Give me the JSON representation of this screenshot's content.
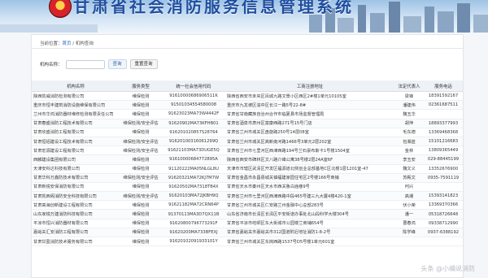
{
  "header": {
    "title": "甘肃省社会消防服务信息管理系统",
    "brand_color": "#1f4fa0"
  },
  "breadcrumb": {
    "prefix": "当前位置：",
    "home": "首页",
    "sep": " / ",
    "current": "机构查询"
  },
  "search": {
    "label": "机构名称：",
    "value": "",
    "placeholder": "",
    "query_label": "查询",
    "reset_label": "重置查询"
  },
  "table": {
    "columns": [
      "机构名称",
      "服务类型",
      "统一社会信用代码",
      "工商注册地址",
      "法定代表人",
      "服务电话"
    ],
    "rows": [
      [
        "陕西凯威消防检测有限公司",
        "维保检测",
        "91610000686906511K",
        "陕西省西安市未央区凤城九路文景小区西区2#楼1单元10105室",
        "梁锋",
        "18391592167"
      ],
      [
        "重庆市恒丰建筑消防设施维保有限公司",
        "维保检测",
        "91501034554580008",
        "重庆市九龙坡区渝中区长江一路5号22-8#",
        "潘建伟",
        "02361687511"
      ],
      [
        "兰州市华鸿消防器材维修检测有限责任公司",
        "维保检测",
        "91623023MA73W4442F",
        "甘肃省甘南藏族自治州合作市临夏县市场监督管理局",
        "魏玉华",
        ""
      ],
      [
        "甘肃春盛消防工程技术有限公司",
        "维保检测/安全评估",
        "91620902MA73KFHB01",
        "甘肃省酒泉市肃州区富康西路271号15号门店",
        "胡萍",
        "18893377993"
      ],
      [
        "甘肃欣盛消防工程有限公司",
        "维保检测",
        "916201020857S28764",
        "甘肃省兰州市城关区盘旋路250号14层08室",
        "毛东德",
        "13369468368"
      ],
      [
        "甘肃恒铝建设工程技术有限公司",
        "维保检测/安全评估",
        "91620100316061299Q",
        "甘肃省兰州市城关区高新南河路1466号3单元2层202室",
        "包湘蓝",
        "15101216683"
      ],
      [
        "甘肃宏源建设工程有限公司",
        "维保检测/安全评估",
        "91621103MA73DUGE5Q",
        "甘肃省兰州市七里河区西津西路194号兰石豪布斯卡1号楼1504室",
        "金林",
        "13809365449"
      ],
      [
        "西麟建设集团有限公司",
        "维保检测",
        "91610000684772895A",
        "陕西省西安市碑林区文八路介峰公寓38号楼2层24A室6F",
        "李玉安",
        "029-88445199"
      ],
      [
        "天津安科达科技有限公司",
        "维保检测",
        "91120222MA05NLGL8U",
        "天津市市辖区武清区开发区福源道北侧创业总部基地C区北楼1层1201室-47",
        "魏文义",
        "13352676900"
      ],
      [
        "甘肃华科万鑫防技术有限公司",
        "维保检测/安全评估",
        "91620321MA72KJ7M7W",
        "甘肃省金昌市永昌县城关镇福建家园住宅区2号楼166号商铺",
        "苏殿文",
        "0935-7591119"
      ],
      [
        "甘肃新锐安保消防有限公司",
        "维保检测",
        "91620502MA7318TB4X",
        "甘肃省天水市秦州区天水市西关鲁白庙巷9号",
        "何兴",
        ""
      ],
      [
        "甘肃凯西阁消防安全科技有限公司",
        "维保检测/安全评估",
        "91620103MA72JKBH9Q",
        "甘肃省兰州市七里河区西津西路中段465号建三九大厦4楼420-1室",
        "高潮",
        "15393141823"
      ],
      [
        "甘肃高海创新建设工程有限公司",
        "维保检测",
        "91621182MA72CRN64P",
        "甘肃省兰州市城关区仁安路兰州金融中心总部283号",
        "伏小荣",
        "13369370366"
      ],
      [
        "山东家锐万建消防科技有限公司",
        "维保检测",
        "91370113MA3D7QX11B",
        "山东省济南市长清区长清区平安街道办事处北山段科学大楼304号",
        "潘一",
        "05318726648"
      ],
      [
        "平凉市恒兴消防器材有限公司",
        "维保检测",
        "91620800796773291F",
        "甘肃省平凉市崆峒区东大街城市公园楼兰商铺654号",
        "曹春鸿",
        "09338712990"
      ],
      [
        "嘉峪关汇安消防工程有限公司",
        "维保检测",
        "91620200MA733BFEXJ",
        "甘肃省嘉峪关市嘉峪关市312国道附近地址消防1-8-2号",
        "陈学峰",
        "0937-6388192"
      ],
      [
        "甘肃甘盈消防技术服务有限公司",
        "维保检测",
        "91620102091933101Y",
        "甘肃省兰州市城关区东岗西路1537号D5号楼1单元601室",
        "",
        ""
      ]
    ]
  },
  "watermark": "头条 @小编说消防"
}
